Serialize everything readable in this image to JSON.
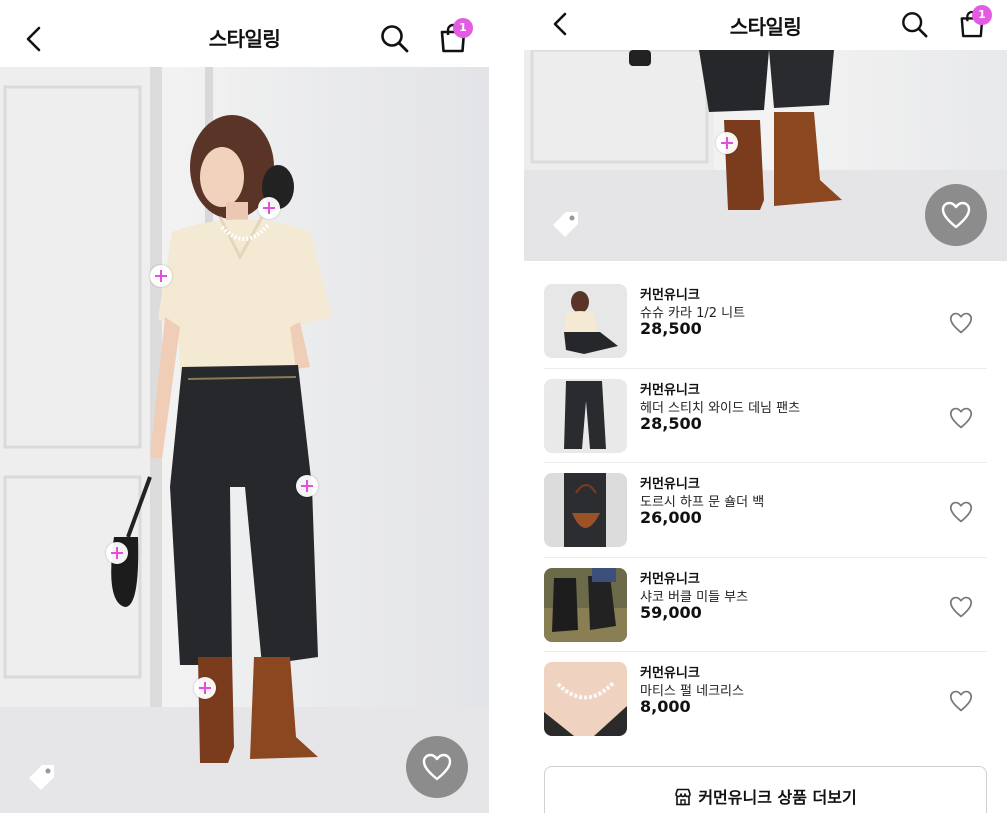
{
  "header": {
    "title": "스타일링",
    "cart_badge": "1"
  },
  "products": [
    {
      "brand": "커먼유니크",
      "name": "슈슈 카라 1/2 니트",
      "price": "28,500",
      "thumb": "sweater"
    },
    {
      "brand": "커먼유니크",
      "name": "헤더 스티치 와이드 데님 팬츠",
      "price": "28,500",
      "thumb": "jeans"
    },
    {
      "brand": "커먼유니크",
      "name": "도르시 하프 문 숄더 백",
      "price": "26,000",
      "thumb": "bag"
    },
    {
      "brand": "커먼유니크",
      "name": "샤코 버클 미들 부츠",
      "price": "59,000",
      "thumb": "boots"
    },
    {
      "brand": "커먼유니크",
      "name": "마티스 펄 네크리스",
      "price": "8,000",
      "thumb": "necklace"
    }
  ],
  "more_button": {
    "label": "커먼유니크 상품 더보기"
  },
  "icons": {
    "back": "chevron-left-icon",
    "search": "search-icon",
    "cart": "shopping-bag-icon",
    "like": "heart-icon",
    "tag": "tag-icon",
    "store": "store-icon"
  },
  "colors": {
    "accent": "#e24fd8",
    "badge": "#e45be3",
    "fab": "#6e6e6e"
  }
}
